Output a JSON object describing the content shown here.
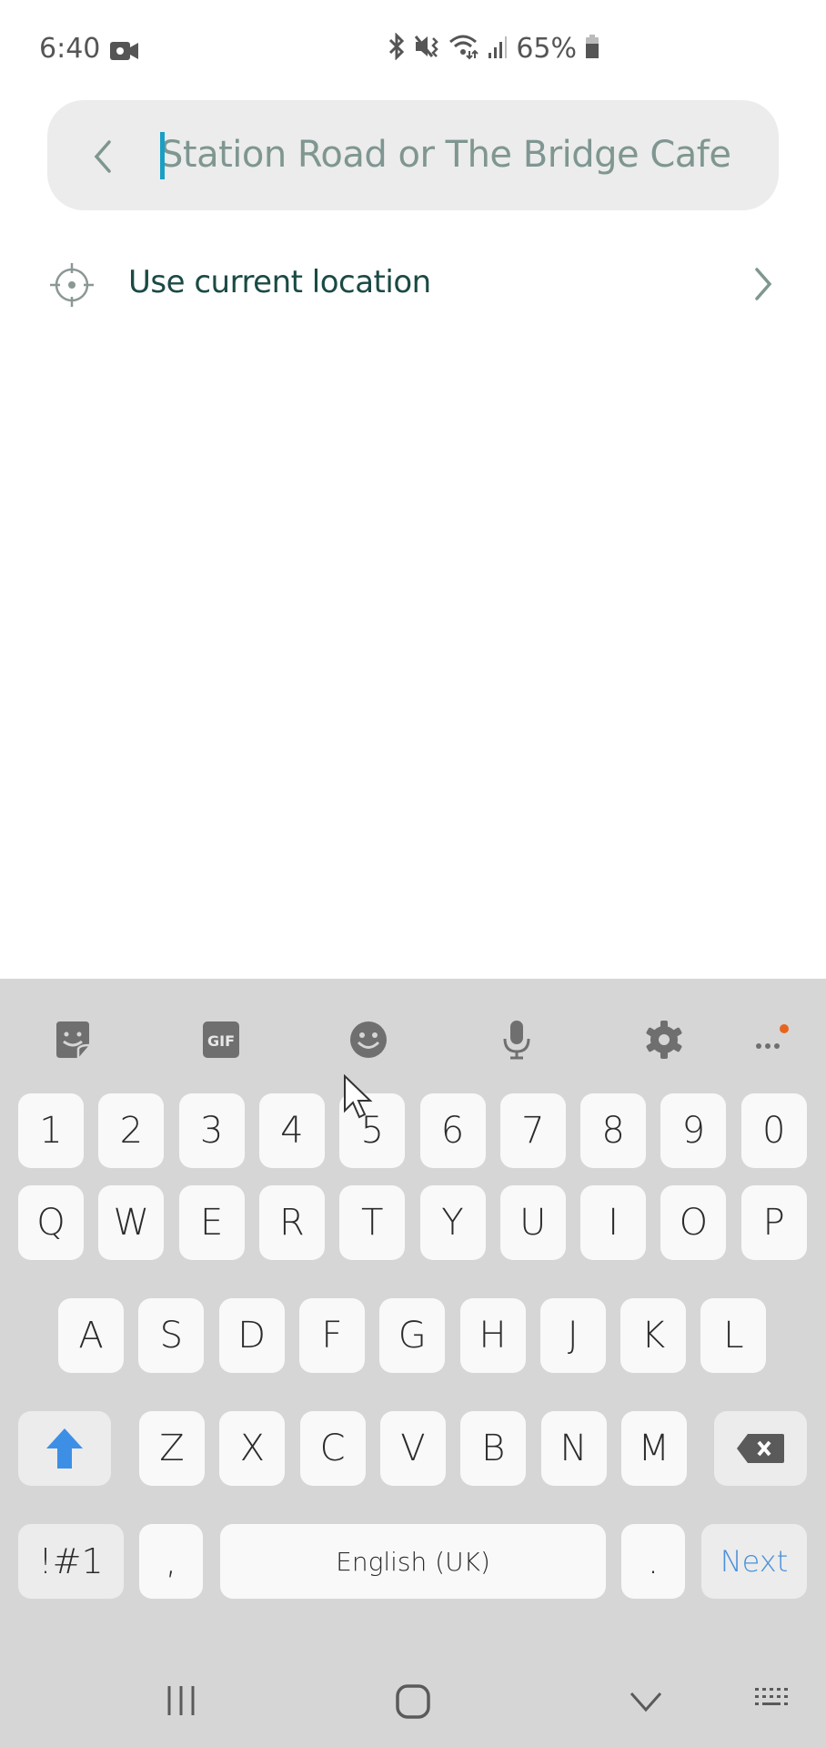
{
  "status_bar": {
    "time": "6:40",
    "battery": "65%",
    "icons": [
      "video-record-icon",
      "bluetooth-icon",
      "mute-vibrate-icon",
      "wifi-icon",
      "signal-icon",
      "battery-icon"
    ]
  },
  "search": {
    "placeholder": "Station Road or The Bridge Cafe",
    "value": ""
  },
  "location_option": {
    "label": "Use current location"
  },
  "keyboard": {
    "toolbar": [
      "sticker-icon",
      "gif-icon",
      "emoji-icon",
      "microphone-icon",
      "settings-icon",
      "more-icon"
    ],
    "gif_label": "GIF",
    "number_row": [
      "1",
      "2",
      "3",
      "4",
      "5",
      "6",
      "7",
      "8",
      "9",
      "0"
    ],
    "row1": [
      "Q",
      "W",
      "E",
      "R",
      "T",
      "Y",
      "U",
      "I",
      "O",
      "P"
    ],
    "row2": [
      "A",
      "S",
      "D",
      "F",
      "G",
      "H",
      "J",
      "K",
      "L"
    ],
    "row3": [
      "Z",
      "X",
      "C",
      "V",
      "B",
      "N",
      "M"
    ],
    "symbols_label": "!#1",
    "comma_label": ",",
    "space_label": "English (UK)",
    "period_label": ".",
    "action_label": "Next",
    "accent_color": "#4a90d9"
  },
  "nav_bar": {
    "items": [
      "recent-apps",
      "home",
      "hide-keyboard",
      "keyboard-switch"
    ]
  }
}
